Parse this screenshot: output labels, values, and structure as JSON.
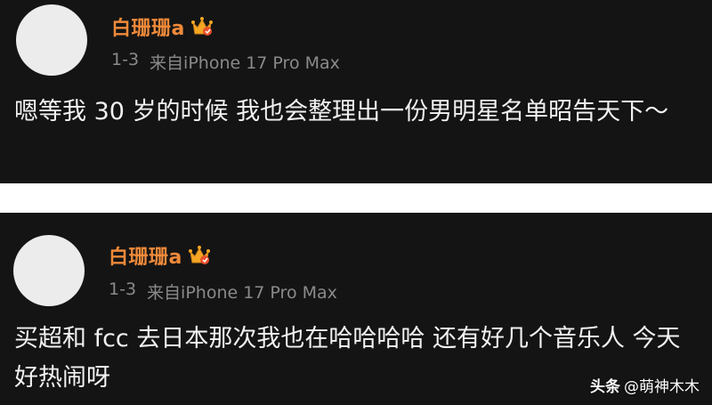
{
  "posts": [
    {
      "username": "白珊珊a",
      "badge_icon": "crown-badge-icon",
      "date": "1-3",
      "source": "来自iPhone 17 Pro Max",
      "content": "嗯等我 30 岁的时候 我也会整理出一份男明星名单昭告天下～"
    },
    {
      "username": "白珊珊a",
      "badge_icon": "crown-badge-icon",
      "date": "1-3",
      "source": "来自iPhone 17 Pro Max",
      "content": "买超和 fcc 去日本那次我也在哈哈哈哈 还有好几个音乐人 今天好热闹呀"
    }
  ],
  "watermark": {
    "brand": "头条",
    "handle": "@萌神木木"
  },
  "colors": {
    "background": "#141414",
    "username": "#f08a3a",
    "meta": "#8a8a8a",
    "text": "#f2f2f2",
    "separator": "#ffffff"
  }
}
